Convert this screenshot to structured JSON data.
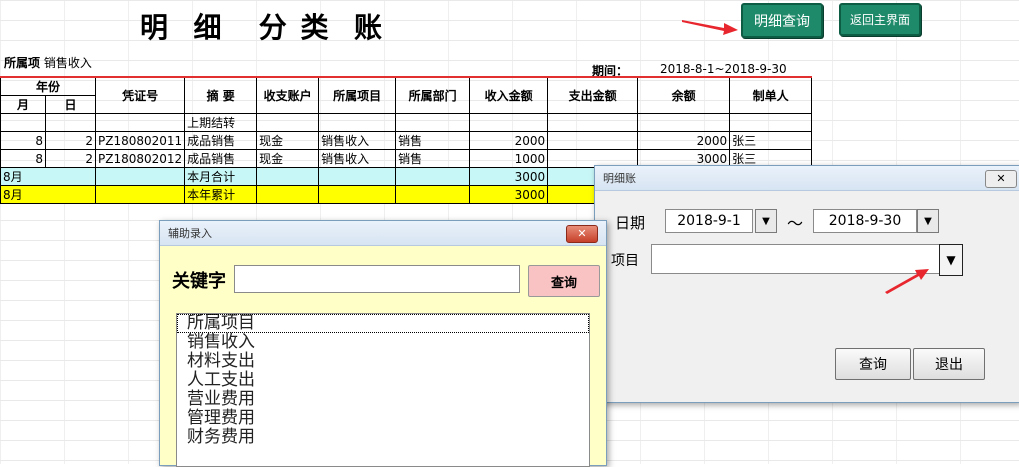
{
  "title": "明  细   分 类  账",
  "buttons": {
    "detail_query": "明细查询",
    "back_main": "返回主界面"
  },
  "project_label": "所属项",
  "project_value": "销售收入",
  "period_label": "期间：",
  "period_value": "2018-8-1~2018-9-30",
  "table": {
    "header_year": "年份",
    "header_month": "月",
    "header_day": "日",
    "columns": [
      "凭证号",
      "摘    要",
      "收支账户",
      "所属项目",
      "所属部门",
      "收入金额",
      "支出金额",
      "余额",
      "制单人"
    ],
    "rows": [
      {
        "m": "",
        "d": "",
        "voucher": "",
        "summary": "上期结转",
        "account": "",
        "item": "",
        "dept": "",
        "income": "",
        "expense": "",
        "balance": "",
        "maker": ""
      },
      {
        "m": "8",
        "d": "2",
        "voucher": "PZ180802011",
        "summary": "成品销售",
        "account": "现金",
        "item": "销售收入",
        "dept": "销售",
        "income": "2000",
        "expense": "",
        "balance": "2000",
        "maker": "张三"
      },
      {
        "m": "8",
        "d": "2",
        "voucher": "PZ180802012",
        "summary": "成品销售",
        "account": "现金",
        "item": "销售收入",
        "dept": "销售",
        "income": "1000",
        "expense": "",
        "balance": "3000",
        "maker": "张三"
      }
    ],
    "month_total": {
      "label": "8月",
      "summary": "本月合计",
      "income": "3000"
    },
    "year_total": {
      "label": "8月",
      "summary": "本年累计",
      "income": "3000"
    }
  },
  "detail_dialog": {
    "title": "明细账",
    "date_label": "日期",
    "date_from": "2018-9-1",
    "tilde": "～",
    "date_to": "2018-9-30",
    "item_label": "项目",
    "item_value": "",
    "query": "查询",
    "exit": "退出"
  },
  "aux_dialog": {
    "title": "辅助录入",
    "keyword_label": "关键字",
    "keyword_value": "",
    "query": "查询",
    "items": [
      "所属项目",
      "销售收入",
      "材料支出",
      "人工支出",
      "营业费用",
      "管理费用",
      "财务费用"
    ]
  },
  "colors": {
    "accent_green": "#1f8a6a",
    "month_row": "#c8f7f7",
    "year_row": "#ffff00",
    "arrow": "#e8262e"
  }
}
